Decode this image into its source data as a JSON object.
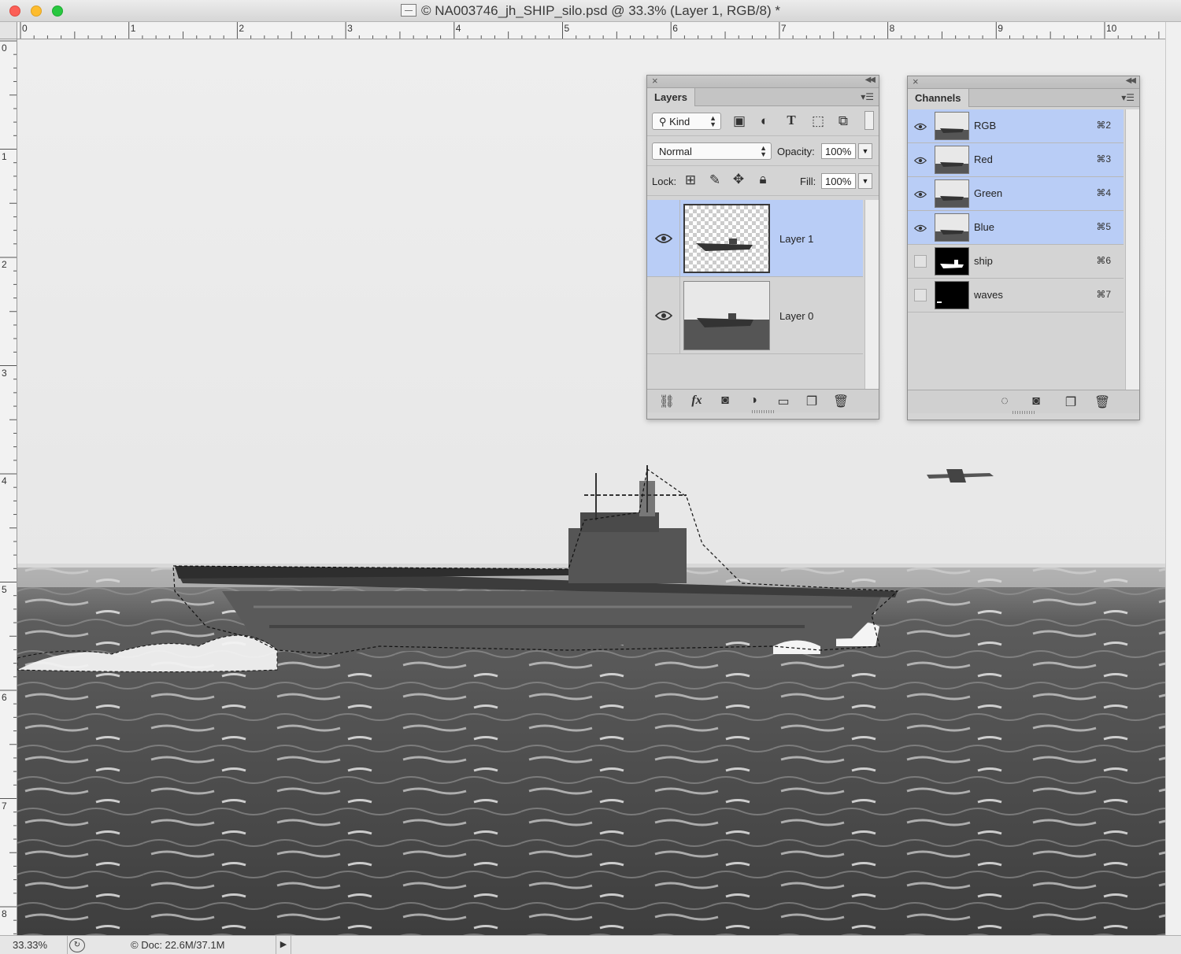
{
  "window": {
    "title": "© NA003746_jh_SHIP_silo.psd @ 33.3% (Layer 1, RGB/8) *"
  },
  "rulers": {
    "top": [
      "0",
      "1",
      "2",
      "3",
      "4",
      "5",
      "6",
      "7",
      "8",
      "9",
      "10"
    ],
    "left": [
      "0",
      "1",
      "2",
      "3",
      "4",
      "5",
      "6",
      "7",
      "8"
    ]
  },
  "layers_panel": {
    "tab": "Layers",
    "filter_kind": "Kind",
    "blend_mode": "Normal",
    "opacity_label": "Opacity:",
    "opacity_value": "100%",
    "lock_label": "Lock:",
    "fill_label": "Fill:",
    "fill_value": "100%",
    "layers": [
      {
        "name": "Layer 1",
        "selected": true,
        "visible": true
      },
      {
        "name": "Layer 0",
        "selected": false,
        "visible": true
      }
    ]
  },
  "channels_panel": {
    "tab": "Channels",
    "channels": [
      {
        "name": "RGB",
        "shortcut": "⌘2",
        "selected": true,
        "visible": true
      },
      {
        "name": "Red",
        "shortcut": "⌘3",
        "selected": true,
        "visible": true
      },
      {
        "name": "Green",
        "shortcut": "⌘4",
        "selected": true,
        "visible": true
      },
      {
        "name": "Blue",
        "shortcut": "⌘5",
        "selected": true,
        "visible": true
      },
      {
        "name": "ship",
        "shortcut": "⌘6",
        "selected": false,
        "visible": false
      },
      {
        "name": "waves",
        "shortcut": "⌘7",
        "selected": false,
        "visible": false
      }
    ]
  },
  "status": {
    "zoom": "33.33%",
    "doc": "Doc: 22.6M/37.1M"
  },
  "colors": {
    "selection_blue": "#b9cdf6",
    "panel_bg": "#d4d4d4"
  }
}
